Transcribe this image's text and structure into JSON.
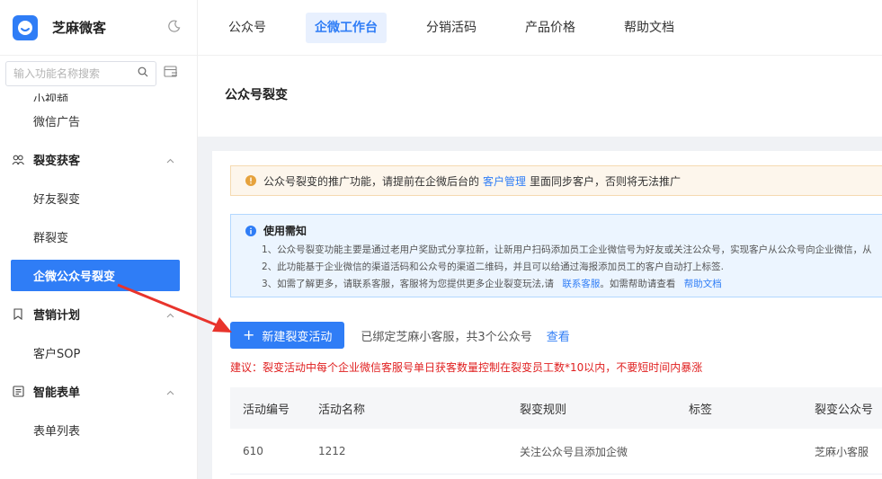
{
  "brand": {
    "name": "芝麻微客"
  },
  "sidebar": {
    "search_placeholder": "输入功能名称搜索",
    "items": [
      {
        "label": "小视频"
      },
      {
        "label": "微信广告"
      },
      {
        "label": "裂变获客"
      },
      {
        "label": "好友裂变"
      },
      {
        "label": "群裂变"
      },
      {
        "label": "企微公众号裂变"
      },
      {
        "label": "营销计划"
      },
      {
        "label": "客户SOP"
      },
      {
        "label": "智能表单"
      },
      {
        "label": "表单列表"
      }
    ]
  },
  "topnav": {
    "tabs": [
      {
        "label": "公众号"
      },
      {
        "label": "企微工作台"
      },
      {
        "label": "分销活码"
      },
      {
        "label": "产品价格"
      },
      {
        "label": "帮助文档"
      }
    ]
  },
  "page": {
    "title": "公众号裂变"
  },
  "warning": {
    "text_before": "公众号裂变的推广功能，请提前在企微后台的",
    "link": "客户管理",
    "text_after": "里面同步客户，否则将无法推广"
  },
  "notice": {
    "title": "使用需知",
    "line1": "1、公众号裂变功能主要是通过老用户奖励式分享拉新，让新用户扫码添加员工企业微信号为好友或关注公众号，实现客户从公众号向企业微信，从",
    "line2": "2、此功能基于企业微信的渠道活码和公众号的渠道二维码，并且可以给通过海报添加员工的客户自动打上标签.",
    "line3_before": "3、如需了解更多，请联系客服，客服将为您提供更多企业裂变玩法,请",
    "line3_link1": "联系客服",
    "line3_middle": "。如需帮助请查看",
    "line3_link2": "帮助文档"
  },
  "actions": {
    "new_button": "新建裂变活动",
    "bind_info": "已绑定芝麻小客服，共3个公众号",
    "view_link": "查看"
  },
  "suggestion": "建议：裂变活动中每个企业微信客服号单日获客数量控制在裂变员工数*10以内，不要短时间内暴涨",
  "table": {
    "headers": [
      "活动编号",
      "活动名称",
      "裂变规则",
      "标签",
      "裂变公众号"
    ],
    "rows": [
      {
        "id": "610",
        "name": "1212",
        "rule": "关注公众号且添加企微",
        "tag": "",
        "account": "芝麻小客服"
      }
    ]
  },
  "colors": {
    "primary": "#2f7df6",
    "warning_bg": "#fdf6ec",
    "info_bg": "#ecf5ff",
    "danger": "#e02020",
    "arrow": "#e8342c"
  }
}
